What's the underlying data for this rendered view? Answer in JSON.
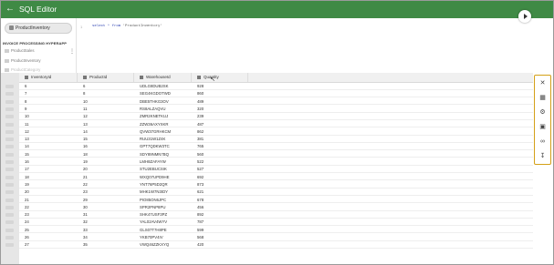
{
  "app": {
    "title": "SQL Editor"
  },
  "sidebar": {
    "db_selector": "ProductInventory",
    "section_title": "INVOICE PROCESSING HYPERAPP",
    "items": [
      "ProductSales",
      "ProductInventory",
      "ProductCategory"
    ]
  },
  "editor": {
    "line_number": "1",
    "sql_keyword": "select * from",
    "sql_table": "'ProductInventory'"
  },
  "results": {
    "columns": [
      "InventoryId",
      "ProductId",
      "WarehouseId",
      "Quantity"
    ],
    "rows": [
      [
        "6",
        "6",
        "UDLG8DUB2SK",
        "928"
      ],
      [
        "7",
        "8",
        "SEG4KGDOTWD",
        "860"
      ],
      [
        "8",
        "10",
        "DBE5THKG3OV",
        "489"
      ],
      [
        "9",
        "11",
        "RS8ALZAQVU",
        "320"
      ],
      [
        "10",
        "12",
        "ZMR2KNETKUJ",
        "239"
      ],
      [
        "11",
        "13",
        "ZZW36AXYXKR",
        "487"
      ],
      [
        "12",
        "14",
        "QVW37GRHKCM",
        "862"
      ],
      [
        "13",
        "15",
        "RUU31W1Z4K",
        "381"
      ],
      [
        "14",
        "16",
        "GPT7QDKW3TC",
        "765"
      ],
      [
        "15",
        "18",
        "SDY89NMN7BQ",
        "560"
      ],
      [
        "16",
        "19",
        "LMH8ZAFAYW",
        "522"
      ],
      [
        "17",
        "20",
        "STU2EBUCSIK",
        "527"
      ],
      [
        "18",
        "21",
        "WXQ07UPD9HE",
        "692"
      ],
      [
        "19",
        "22",
        "YNT76P5D2QR",
        "873"
      ],
      [
        "20",
        "23",
        "MHK1W7N3IDY",
        "621"
      ],
      [
        "21",
        "29",
        "PIO85ON6JPC",
        "678"
      ],
      [
        "22",
        "30",
        "SPR2PNP8PU",
        "456"
      ],
      [
        "23",
        "31",
        "SHK47USF3PZ",
        "892"
      ],
      [
        "24",
        "32",
        "YAL02AV4WYV",
        "787"
      ],
      [
        "25",
        "33",
        "GLS07T7H8PE",
        "599"
      ],
      [
        "26",
        "34",
        "YKB70PV4IV",
        "568"
      ],
      [
        "27",
        "35",
        "VWQ46ZZKXYQ",
        "420"
      ]
    ]
  },
  "right_panel": {
    "icons": [
      "close-icon",
      "table-icon",
      "settings-icon",
      "export-icon",
      "link-icon",
      "download-icon"
    ]
  }
}
